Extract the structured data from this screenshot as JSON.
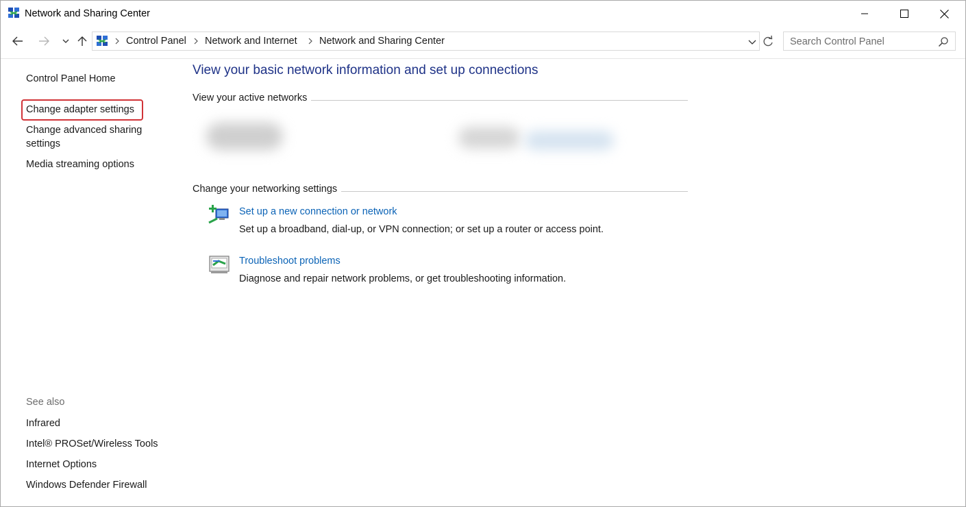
{
  "window": {
    "title": "Network and Sharing Center",
    "controls": {
      "minimize": "minimize-icon",
      "maximize": "maximize-icon",
      "close": "close-icon"
    }
  },
  "addressbar": {
    "breadcrumbs": [
      "Control Panel",
      "Network and Internet",
      "Network and Sharing Center"
    ],
    "search_placeholder": "Search Control Panel"
  },
  "sidebar": {
    "home": "Control Panel Home",
    "tasks": [
      "Change adapter settings",
      "Change advanced sharing",
      "settings",
      "Media streaming options"
    ],
    "see_also_label": "See also",
    "see_also": [
      "Infrared",
      "Intel® PROSet/Wireless Tools",
      "Internet Options",
      "Windows Defender Firewall"
    ]
  },
  "main": {
    "heading": "View your basic network information and set up connections",
    "active_networks_title": "View your active networks",
    "settings_title": "Change your networking settings",
    "tasks": [
      {
        "icon": "new-connection-icon",
        "link": "Set up a new connection or network",
        "description": "Set up a broadband, dial-up, or VPN connection; or set up a router or access point."
      },
      {
        "icon": "troubleshoot-icon",
        "link": "Troubleshoot problems",
        "description": "Diagnose and repair network problems, or get troubleshooting information."
      }
    ]
  },
  "colors": {
    "heading": "#1e3287",
    "link": "#0b63b6",
    "highlight": "#d13438"
  }
}
